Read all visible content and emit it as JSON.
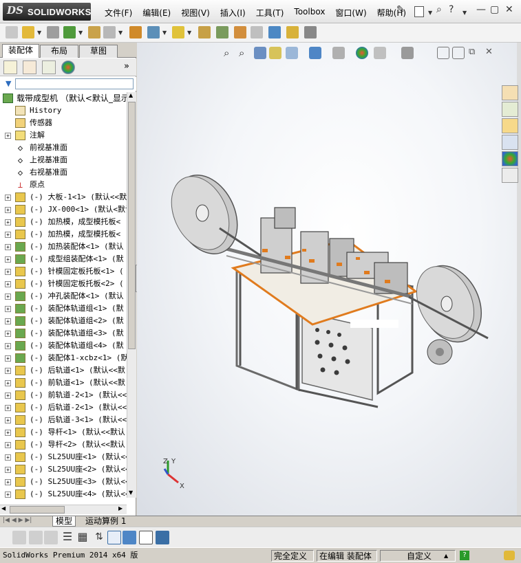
{
  "app": {
    "logo_ds": "DS",
    "logo_name": "SOLIDWORKS"
  },
  "menus": [
    "文件(F)",
    "编辑(E)",
    "视图(V)",
    "插入(I)",
    "工具(T)",
    "Toolbox",
    "窗口(W)",
    "帮助(H)"
  ],
  "window_controls": {
    "minimize": "—",
    "restore": "▢",
    "close": "✕"
  },
  "left_tabs": [
    "装配体",
    "布局",
    "草图"
  ],
  "tree": {
    "root_label": "载带成型机 （默认<默认_显示",
    "nodes": [
      {
        "label": "History",
        "icon": "history-icon",
        "expandable": false
      },
      {
        "label": "传感器",
        "icon": "sensor-icon",
        "expandable": false
      },
      {
        "label": "注解",
        "icon": "annotation-icon",
        "expandable": true
      },
      {
        "label": "前视基准面",
        "icon": "plane-icon",
        "expandable": false
      },
      {
        "label": "上视基准面",
        "icon": "plane-icon",
        "expandable": false
      },
      {
        "label": "右视基准面",
        "icon": "plane-icon",
        "expandable": false
      },
      {
        "label": "原点",
        "icon": "origin-icon",
        "expandable": false
      },
      {
        "label": "(-) 大板-1<1> (默认<<默",
        "icon": "part-icon",
        "expandable": true
      },
      {
        "label": "(-) JX-000<1> (默认<默认",
        "icon": "part-icon",
        "expandable": true
      },
      {
        "label": "(-) 加热模，成型模托板<",
        "icon": "part-icon",
        "expandable": true
      },
      {
        "label": "(-) 加热模，成型模托板<",
        "icon": "part-icon",
        "expandable": true
      },
      {
        "label": "(-) 加热装配体<1> (默认",
        "icon": "assembly-icon",
        "expandable": true
      },
      {
        "label": "(-) 成型组装配体<1> (默",
        "icon": "assembly-icon",
        "expandable": true
      },
      {
        "label": "(-) 针模固定板托板<1> (",
        "icon": "part-icon",
        "expandable": true
      },
      {
        "label": "(-) 针模固定板托板<2> (",
        "icon": "part-icon",
        "expandable": true
      },
      {
        "label": "(-) 冲孔装配体<1> (默认",
        "icon": "assembly-icon",
        "expandable": true
      },
      {
        "label": "(-) 装配体轨道组<1> (默",
        "icon": "assembly-icon",
        "expandable": true
      },
      {
        "label": "(-) 装配体轨道组<2> (默",
        "icon": "assembly-icon",
        "expandable": true
      },
      {
        "label": "(-) 装配体轨道组<3> (默",
        "icon": "assembly-icon",
        "expandable": true
      },
      {
        "label": "(-) 装配体轨道组<4> (默",
        "icon": "assembly-icon",
        "expandable": true
      },
      {
        "label": "(-) 装配体1-xcbz<1> (默",
        "icon": "assembly-icon",
        "expandable": true
      },
      {
        "label": "(-) 后轨道<1> (默认<<默",
        "icon": "part-icon",
        "expandable": true
      },
      {
        "label": "(-) 前轨道<1> (默认<<默",
        "icon": "part-icon",
        "expandable": true
      },
      {
        "label": "(-) 前轨道-2<1> (默认<<",
        "icon": "part-icon",
        "expandable": true
      },
      {
        "label": "(-) 后轨道-2<1> (默认<<",
        "icon": "part-icon",
        "expandable": true
      },
      {
        "label": "(-) 后轨道-3<1> (默认<<",
        "icon": "part-icon",
        "expandable": true
      },
      {
        "label": "(-) 导杆<1> (默认<<默认",
        "icon": "part-icon",
        "expandable": true
      },
      {
        "label": "(-) 导杆<2> (默认<<默认",
        "icon": "part-icon",
        "expandable": true
      },
      {
        "label": "(-) SL25UU座<1> (默认<<",
        "icon": "part-icon",
        "expandable": true
      },
      {
        "label": "(-) SL25UU座<2> (默认<<",
        "icon": "part-icon",
        "expandable": true
      },
      {
        "label": "(-) SL25UU座<3> (默认<<",
        "icon": "part-icon",
        "expandable": true
      },
      {
        "label": "(-) SL25UU座<4> (默认<<",
        "icon": "part-icon",
        "expandable": true
      }
    ]
  },
  "bottom_tabs": [
    "模型",
    "运动算例 1"
  ],
  "status": {
    "product": "SolidWorks Premium 2014 x64 版",
    "definition": "完全定义",
    "mode": "在编辑 装配体",
    "units": "自定义"
  },
  "colors": {
    "accent": "#f08a24",
    "frame": "#6a6a6a",
    "panel": "#d4d0c8"
  }
}
